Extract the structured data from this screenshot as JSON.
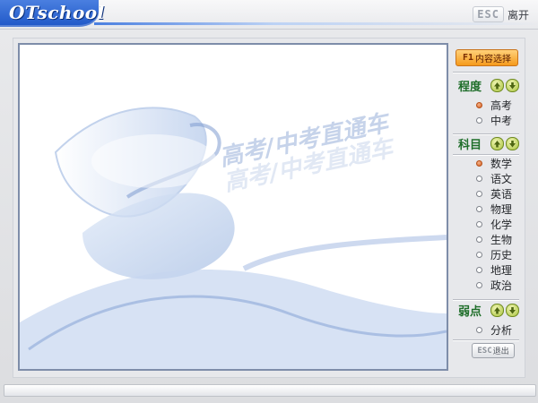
{
  "app": {
    "logo_text": "OTschool"
  },
  "titlebar": {
    "esc_key": "ESC",
    "esc_label": "离开"
  },
  "panel": {
    "f1_key": "F1",
    "f1_label": "内容选择",
    "sections": [
      {
        "title": "程度",
        "items": [
          {
            "label": "高考",
            "selected": true
          },
          {
            "label": "中考",
            "selected": false
          }
        ]
      },
      {
        "title": "科目",
        "items": [
          {
            "label": "数学",
            "selected": true
          },
          {
            "label": "语文",
            "selected": false
          },
          {
            "label": "英语",
            "selected": false
          },
          {
            "label": "物理",
            "selected": false
          },
          {
            "label": "化学",
            "selected": false
          },
          {
            "label": "生物",
            "selected": false
          },
          {
            "label": "历史",
            "selected": false
          },
          {
            "label": "地理",
            "selected": false
          },
          {
            "label": "政治",
            "selected": false
          }
        ]
      },
      {
        "title": "弱点",
        "items": [
          {
            "label": "分析",
            "selected": false
          }
        ]
      }
    ],
    "esc_key": "ESC",
    "esc_label": "退出"
  },
  "stage": {
    "watermark": "高考/中考直通车"
  },
  "colors": {
    "accent_blue": "#1f57c7",
    "section_green": "#1f6e2a",
    "f1_orange": "#f59a1c",
    "selected_radio": "#d25f21"
  }
}
